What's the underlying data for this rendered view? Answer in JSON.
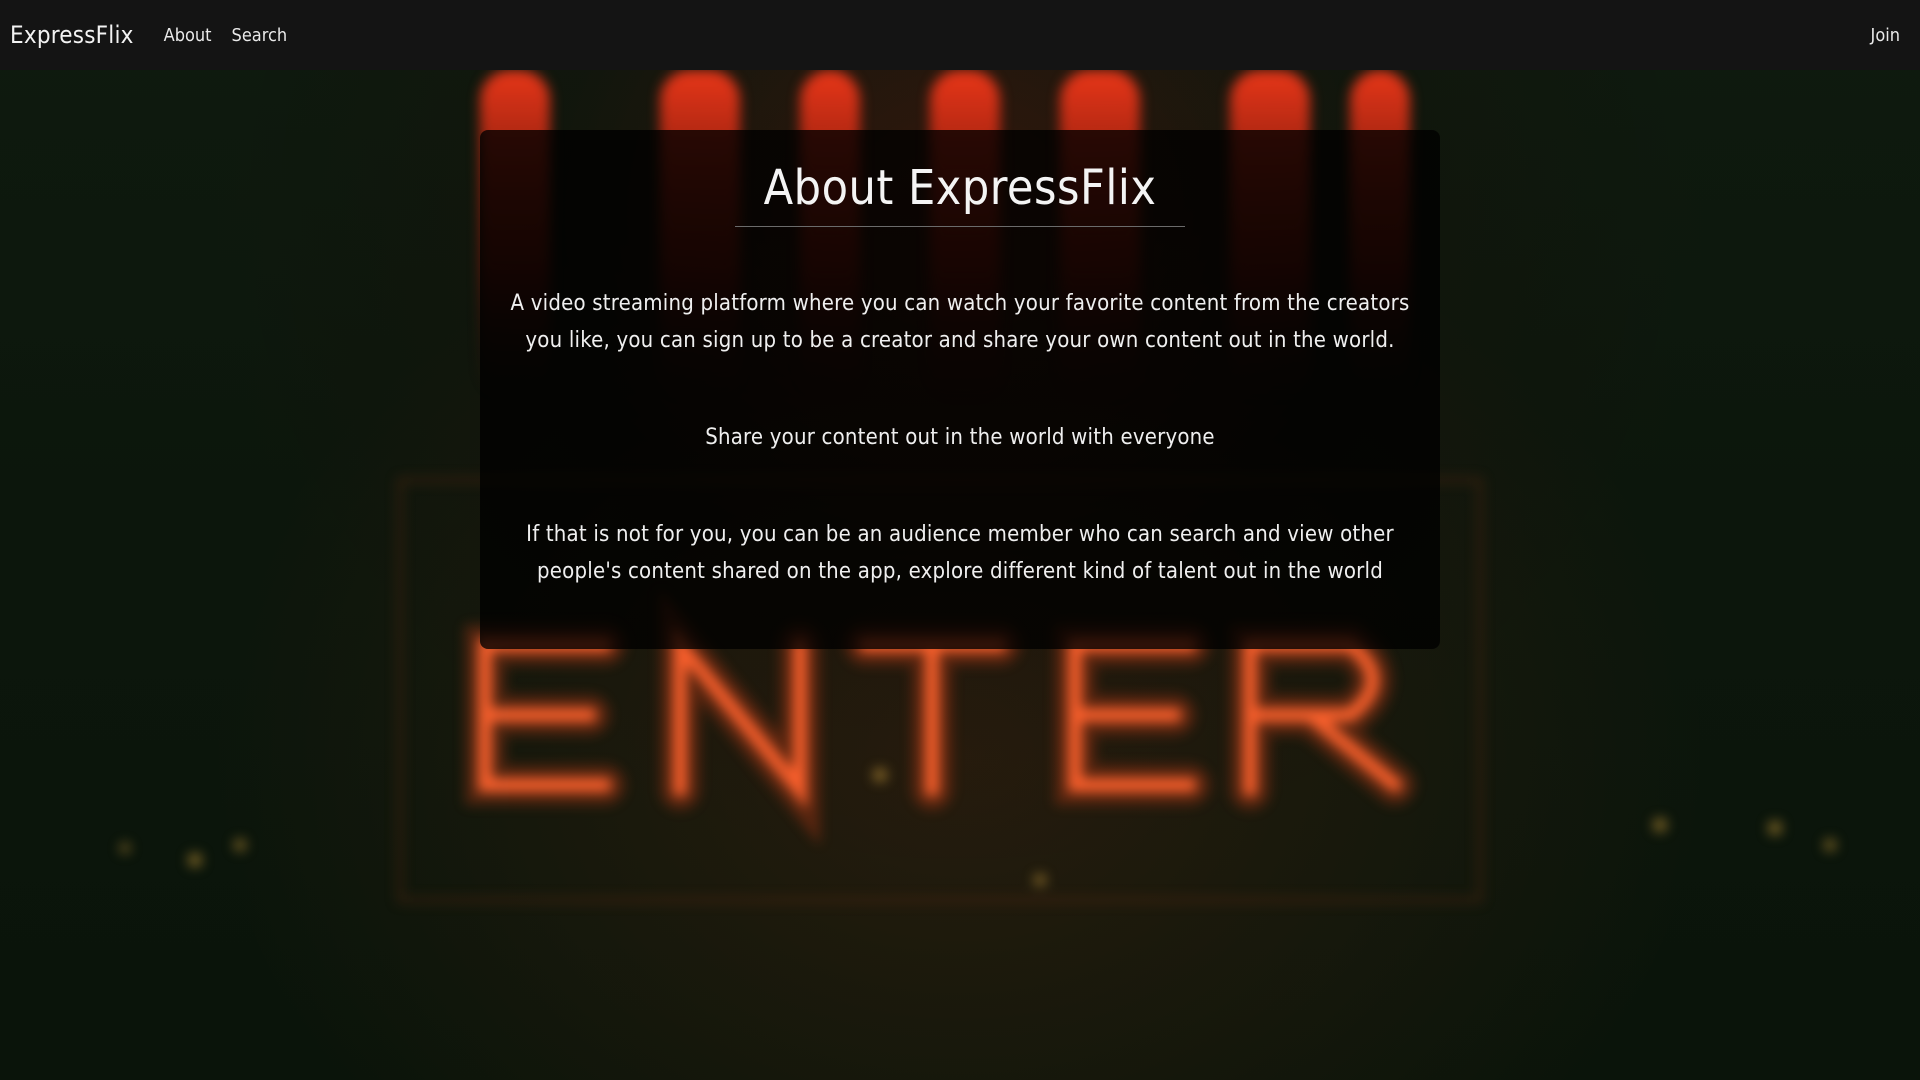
{
  "navbar": {
    "brand": "ExpressFlix",
    "links": [
      "About",
      "Search"
    ],
    "join_label": "Join"
  },
  "card": {
    "title": "About ExpressFlix",
    "paragraphs": [
      "A video streaming platform where you can watch your favorite content from the creators you like, you can sign up to be a creator and share your own content out in the world.",
      "Share your content out in the world with everyone",
      "If that is not for you, you can be an audience member who can search and view other people's content shared on the app, explore different kind of talent out in the world"
    ]
  },
  "background": {
    "neon_text": "ENTER",
    "neon_color": "#ff5a2a"
  }
}
